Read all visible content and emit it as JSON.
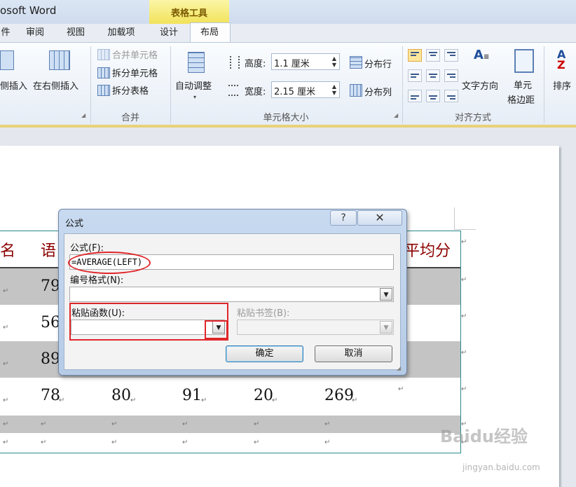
{
  "window": {
    "title": "osoft Word",
    "context_tab": "表格工具"
  },
  "tabs": [
    "件",
    "审阅",
    "视图",
    "加载项",
    "设计",
    "布局"
  ],
  "active_tab": "布局",
  "ribbon": {
    "rows_cols": {
      "insert_left": "侧插入",
      "insert_right": "在右侧插入"
    },
    "merge": {
      "merge_cells": "合并单元格",
      "split_cells": "拆分单元格",
      "split_table": "拆分表格",
      "group_label": "合并"
    },
    "cell_size": {
      "autofit": "自动调整",
      "height_label": "高度:",
      "height_value": "1.1 厘米",
      "width_label": "宽度:",
      "width_value": "2.15 厘米",
      "distribute_rows": "分布行",
      "distribute_cols": "分布列",
      "group_label": "单元格大小"
    },
    "alignment": {
      "text_direction": "文字方向",
      "cell_margins_1": "单元",
      "cell_margins_2": "格边距",
      "group_label": "对齐方式"
    },
    "data": {
      "sort": "排序"
    }
  },
  "table": {
    "headers": [
      "名",
      "语",
      "平均分"
    ],
    "rows": [
      {
        "cells": [
          "79"
        ]
      },
      {
        "cells": [
          "56"
        ]
      },
      {
        "cells": [
          "89"
        ]
      },
      {
        "cells": [
          "78",
          "80",
          "91",
          "20",
          "269"
        ]
      }
    ],
    "cell_mark": "↵"
  },
  "dialog": {
    "title": "公式",
    "help": "?",
    "close": "✕",
    "formula_label": "公式(F):",
    "formula_value": "=AVERAGE(LEFT)",
    "number_format_label": "编号格式(N):",
    "number_format_value": "",
    "paste_function_label": "粘贴函数(U):",
    "paste_function_value": "",
    "paste_bookmark_label": "粘贴书签(B):",
    "paste_bookmark_value": "",
    "ok": "确定",
    "cancel": "取消"
  },
  "watermark": {
    "logo": "Baidu经验",
    "url": "jingyan.baidu.com"
  },
  "colors": {
    "annotation": "#e0262a",
    "header_text": "#8b0000",
    "context_tab": "#f1e25a",
    "table_border": "#2b8a8a"
  }
}
